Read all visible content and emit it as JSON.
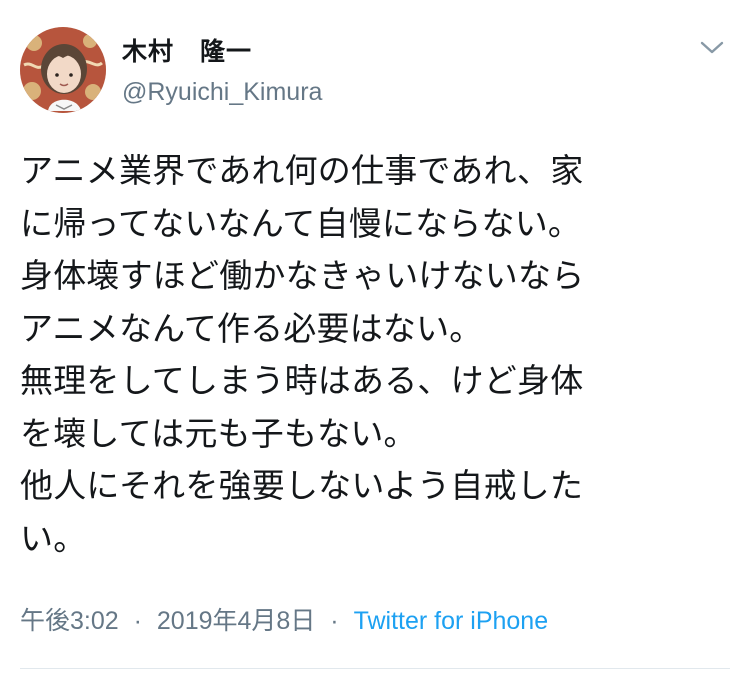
{
  "tweet": {
    "display_name": "木村　隆一",
    "handle": "@Ryuichi_Kimura",
    "lines": [
      "アニメ業界であれ何の仕事であれ、家",
      "に帰ってないなんて自慢にならない。",
      "身体壊すほど働かなきゃいけないなら",
      "アニメなんて作る必要はない。",
      "無理をしてしまう時はある、けど身体",
      "を壊しては元も子もない。",
      "他人にそれを強要しないよう自戒した",
      "い。"
    ],
    "time": "午後3:02",
    "separator": "·",
    "date": "2019年4月8日",
    "source": "Twitter for iPhone"
  },
  "icons": {
    "avatar": "avatar-illustration",
    "menu": "chevron-down-icon"
  },
  "colors": {
    "text": "#14171a",
    "secondary": "#657786",
    "link": "#1da1f2",
    "divider": "#e1e8ed"
  }
}
